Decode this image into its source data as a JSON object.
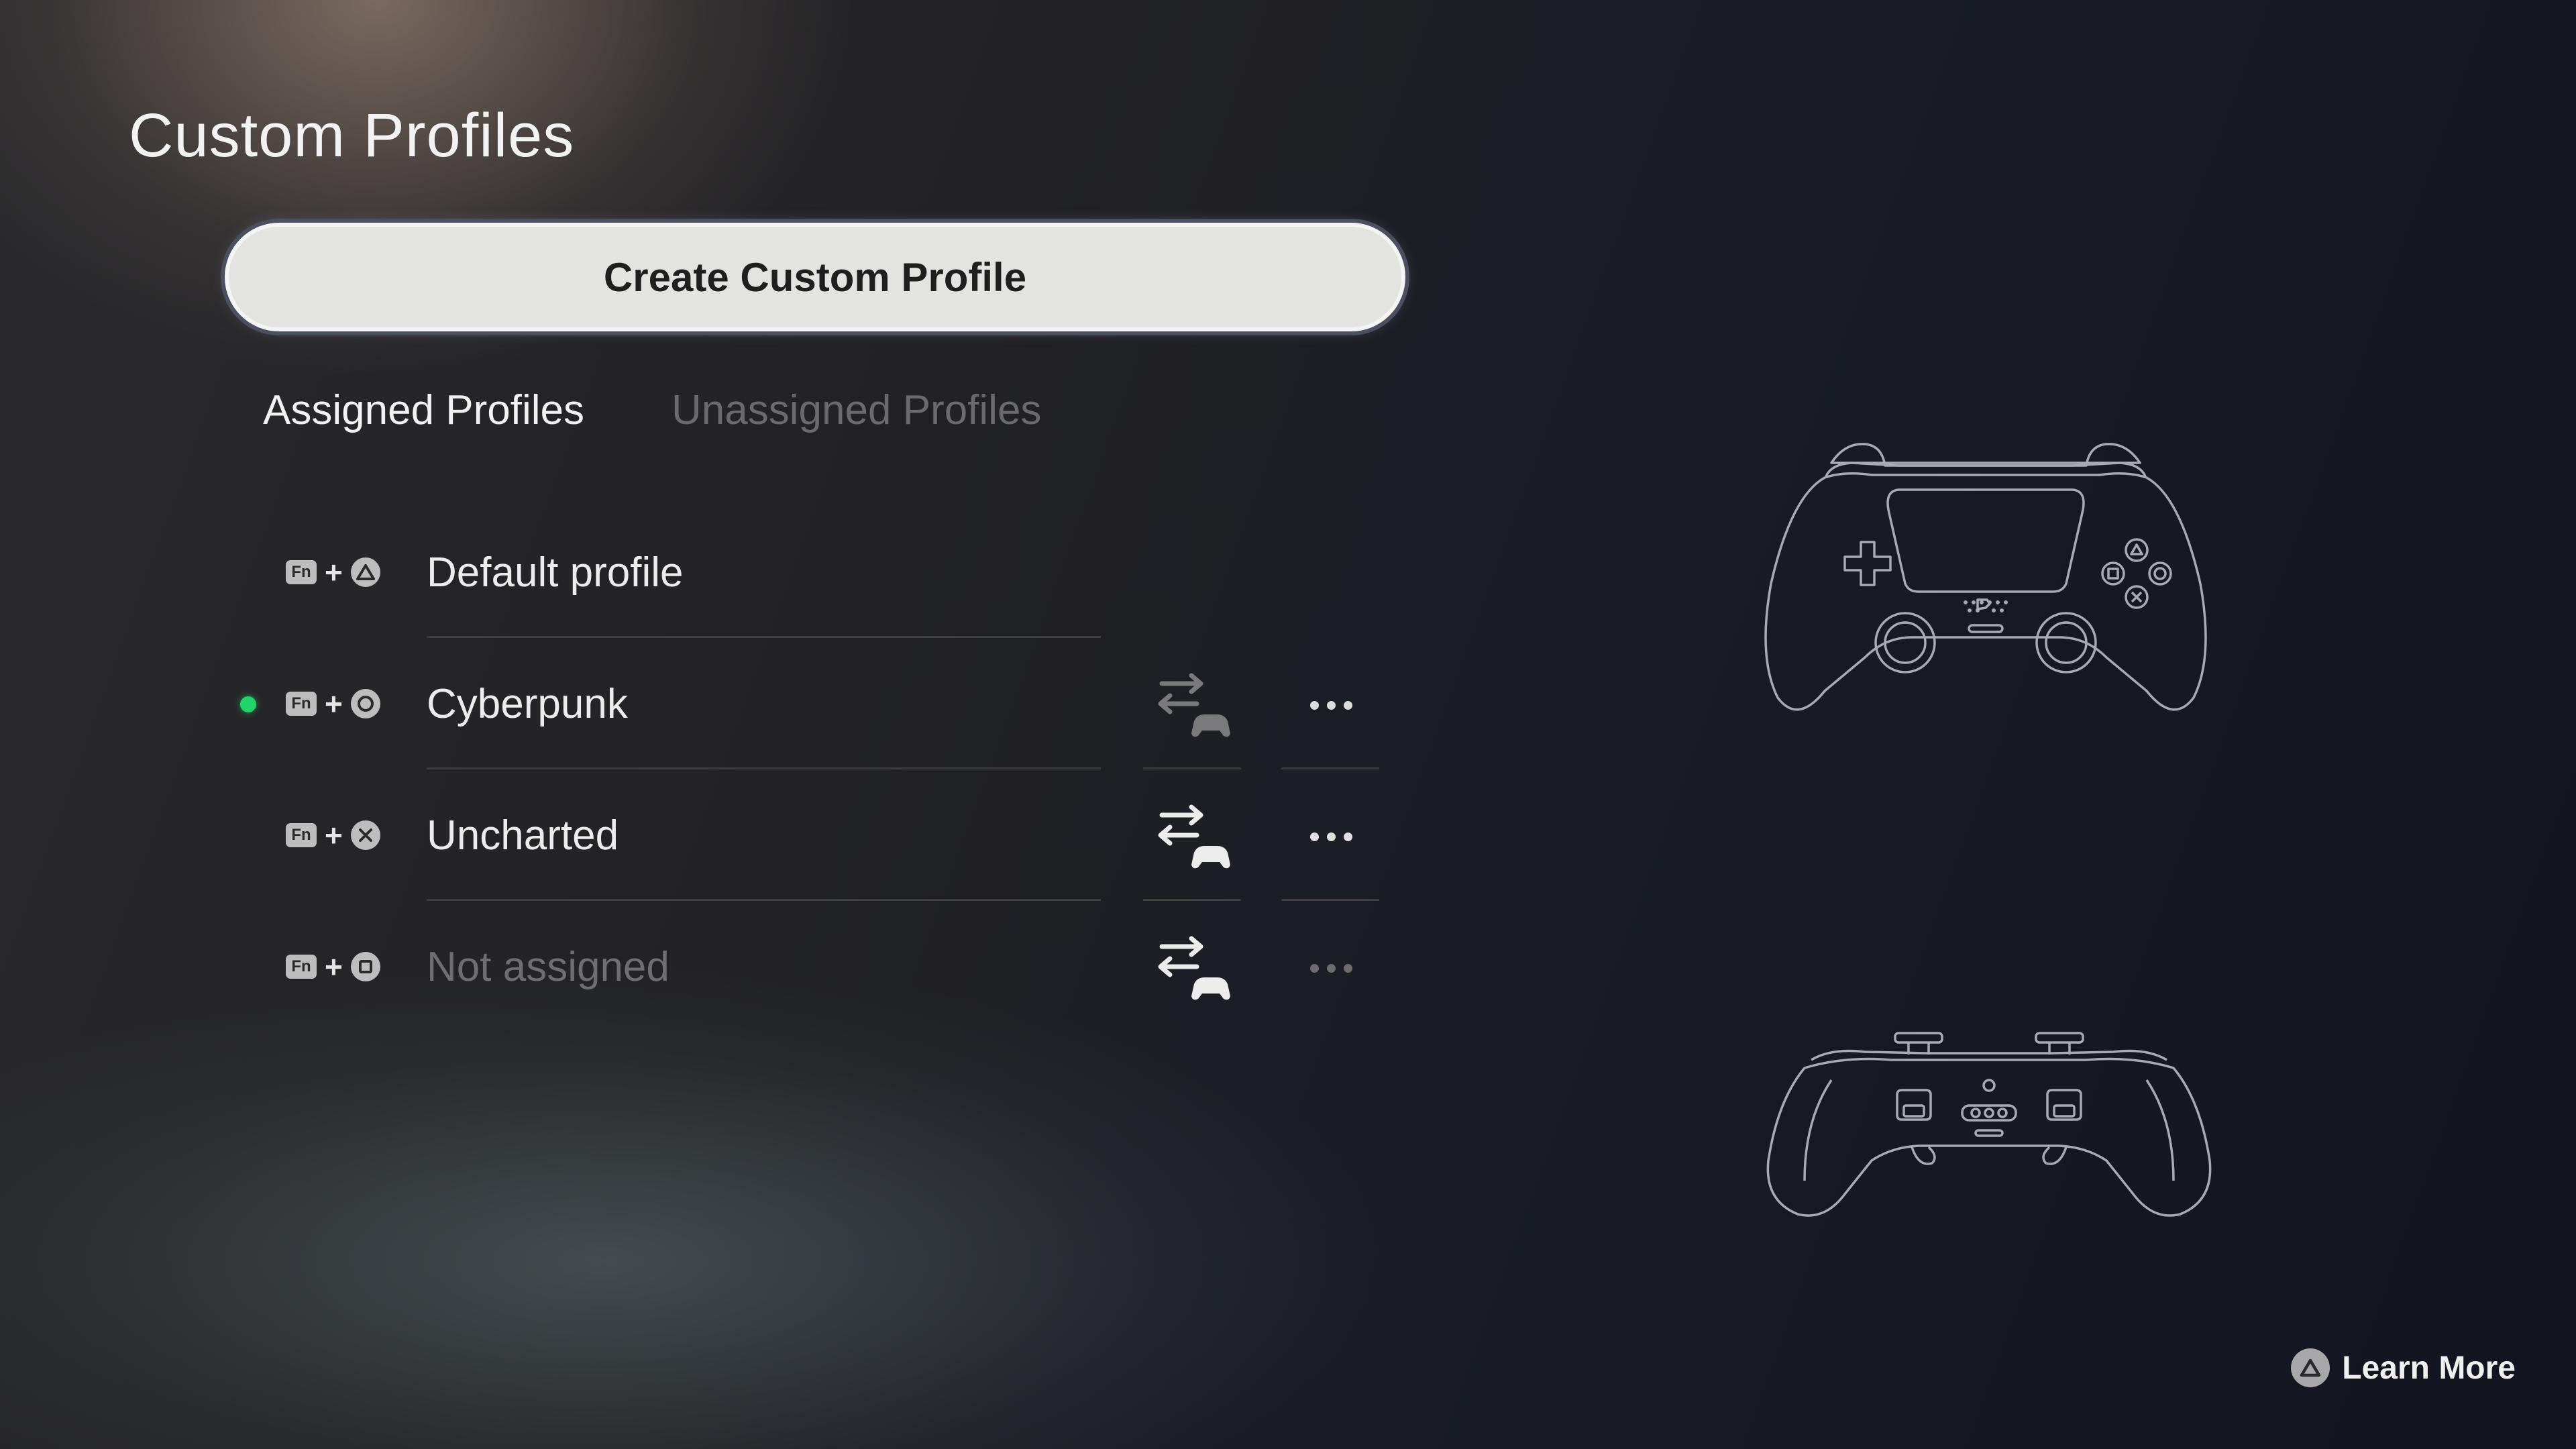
{
  "page": {
    "title": "Custom Profiles"
  },
  "create_button": {
    "label": "Create Custom Profile"
  },
  "tabs": [
    {
      "label": "Assigned Profiles",
      "active": true
    },
    {
      "label": "Unassigned Profiles",
      "active": false
    }
  ],
  "profiles": [
    {
      "shortcut_fn": "Fn",
      "shortcut_plus": "+",
      "shortcut_button": "triangle-icon",
      "name": "Default profile",
      "active": false,
      "has_actions": false,
      "assigned": true
    },
    {
      "shortcut_fn": "Fn",
      "shortcut_plus": "+",
      "shortcut_button": "circle-icon",
      "name": "Cyberpunk",
      "active": true,
      "has_actions": true,
      "assigned": true
    },
    {
      "shortcut_fn": "Fn",
      "shortcut_plus": "+",
      "shortcut_button": "cross-icon",
      "name": "Uncharted",
      "active": false,
      "has_actions": true,
      "assigned": true
    },
    {
      "shortcut_fn": "Fn",
      "shortcut_plus": "+",
      "shortcut_button": "square-icon",
      "name": "Not assigned",
      "active": false,
      "has_actions": true,
      "assigned": false
    }
  ],
  "footer": {
    "learn_more_label": "Learn More",
    "learn_more_icon": "triangle-icon"
  },
  "colors": {
    "active_indicator": "#22d36a",
    "button_bg": "#e3e3e1",
    "focus_ring": "#4b4f60"
  }
}
